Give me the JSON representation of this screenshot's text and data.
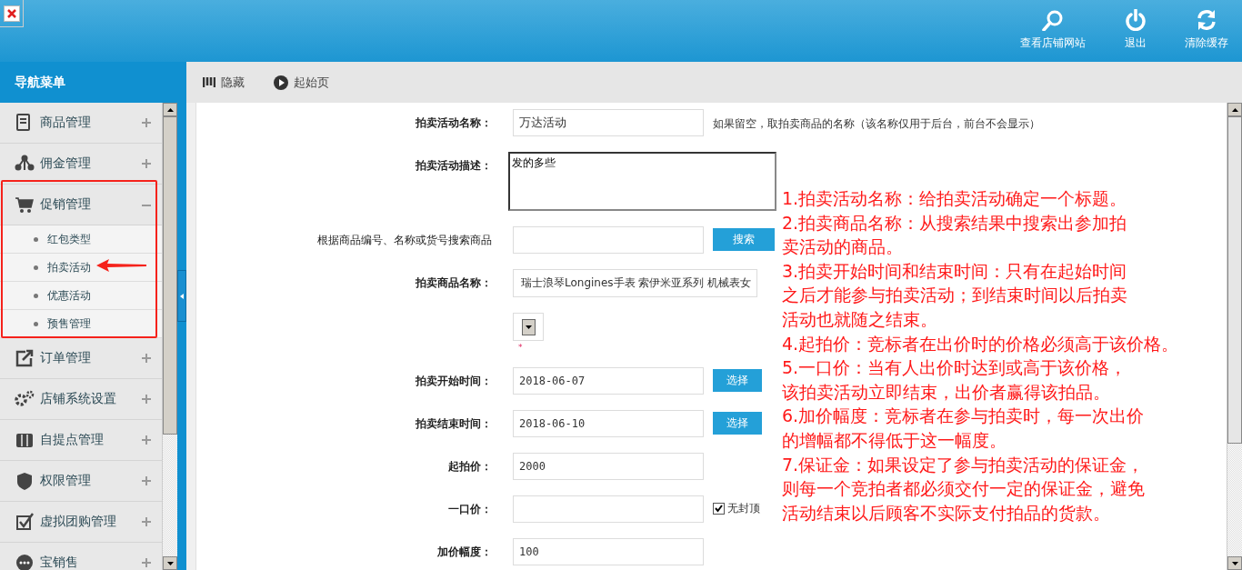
{
  "header": {
    "actions": [
      {
        "label": "查看店铺网站"
      },
      {
        "label": "退出"
      },
      {
        "label": "清除缓存"
      }
    ]
  },
  "sidebar": {
    "title": "导航菜单",
    "items": [
      {
        "label": "商品管理",
        "expanded": false
      },
      {
        "label": "佣金管理",
        "expanded": false
      },
      {
        "label": "促销管理",
        "expanded": true,
        "children": [
          {
            "label": "红包类型"
          },
          {
            "label": "拍卖活动"
          },
          {
            "label": "优惠活动"
          },
          {
            "label": "预售管理"
          }
        ]
      },
      {
        "label": "订单管理",
        "expanded": false
      },
      {
        "label": "店铺系统设置",
        "expanded": false
      },
      {
        "label": "自提点管理",
        "expanded": false
      },
      {
        "label": "权限管理",
        "expanded": false
      },
      {
        "label": "虚拟团购管理",
        "expanded": false
      },
      {
        "label": "宝销售",
        "expanded": false
      }
    ]
  },
  "toolbar": [
    {
      "label": "隐藏"
    },
    {
      "label": "起始页"
    }
  ],
  "form": [
    {
      "kind": "text",
      "label": "拍卖活动名称：",
      "value": "万达活动",
      "hint": "如果留空，取拍卖商品的名称（该名称仅用于后台，前台不会显示）"
    },
    {
      "kind": "textarea",
      "label": "拍卖活动描述：",
      "value": "发的多些"
    },
    {
      "kind": "search",
      "label": "根据商品编号、名称或货号搜索商品",
      "button": "搜索"
    },
    {
      "kind": "select",
      "label": "拍卖商品名称：",
      "value": "瑞士浪琴Longines手表 索伊米亚系列 机械表女"
    },
    {
      "kind": "dropdown",
      "required_mark": "*"
    },
    {
      "kind": "date",
      "label": "拍卖开始时间：",
      "value": "2018-06-07",
      "button": "选择"
    },
    {
      "kind": "date",
      "label": "拍卖结束时间：",
      "value": "2018-06-10",
      "button": "选择"
    },
    {
      "kind": "text",
      "label": "起拍价：",
      "value": "2000"
    },
    {
      "kind": "checkbox",
      "label": "一口价：",
      "checkbox_label": "无封顶",
      "checked": true
    },
    {
      "kind": "text",
      "label": "加价幅度：",
      "value": "100"
    }
  ],
  "annotation": [
    "1.拍卖活动名称：给拍卖活动确定一个标题。",
    "2.拍卖商品名称：从搜索结果中搜索出参加拍",
    "卖活动的商品。",
    "3.拍卖开始时间和结束时间：只有在起始时间",
    "之后才能参与拍卖活动；到结束时间以后拍卖",
    "活动也就随之结束。",
    "4.起拍价：竞标者在出价时的价格必须高于该价格。",
    "5.一口价：当有人出价时达到或高于该价格，",
    "该拍卖活动立即结束，出价者赢得该拍品。",
    "6.加价幅度：竞标者在参与拍卖时，每一次出价",
    "的增幅都不得低于这一幅度。",
    "7.保证金：如果设定了参与拍卖活动的保证金，",
    "则每一个竞拍者都必须交付一定的保证金，避免",
    "活动结束以后顾客不实际支付拍品的货款。"
  ]
}
